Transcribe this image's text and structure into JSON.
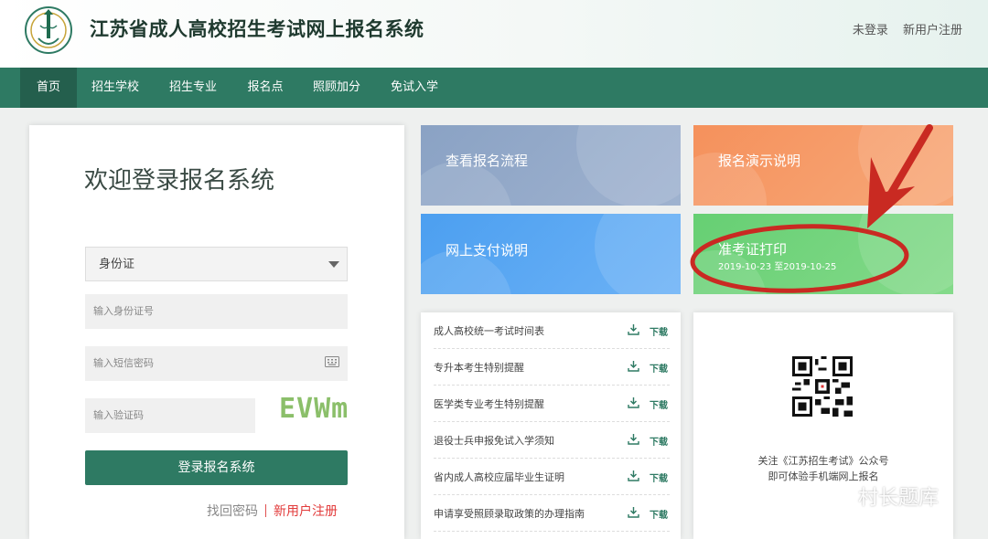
{
  "header": {
    "title": "江苏省成人高校招生考试网上报名系统",
    "not_logged_in": "未登录",
    "register": "新用户注册"
  },
  "nav": {
    "items": [
      "首页",
      "招生学校",
      "招生专业",
      "报名点",
      "照顾加分",
      "免试入学"
    ],
    "active_index": 0
  },
  "login": {
    "title": "欢迎登录报名系统",
    "id_type": "身份证",
    "id_placeholder": "输入身份证号",
    "sms_placeholder": "输入短信密码",
    "captcha_placeholder": "输入验证码",
    "captcha_text": "EVWm",
    "submit": "登录报名系统",
    "forgot": "找回密码",
    "register": "新用户注册"
  },
  "tiles": {
    "flow": "查看报名流程",
    "demo": "报名演示说明",
    "pay": "网上支付说明",
    "admission": "准考证打印",
    "admission_dates": "2019-10-23 至2019-10-25"
  },
  "downloads": {
    "link_label": "下载",
    "items": [
      "成人高校统一考试时间表",
      "专升本考生特别提醒",
      "医学类专业考生特别提醒",
      "退役士兵申报免试入学须知",
      "省内成人高校应届毕业生证明",
      "申请享受照顾录取政策的办理指南"
    ]
  },
  "qr": {
    "line1": "关注《江苏招生考试》公众号",
    "line2": "即可体验手机端网上报名"
  },
  "watermark": "村长题库",
  "colors": {
    "primary": "#2e7a63",
    "annotation": "#c92a22",
    "register_red": "#e23b3b"
  }
}
